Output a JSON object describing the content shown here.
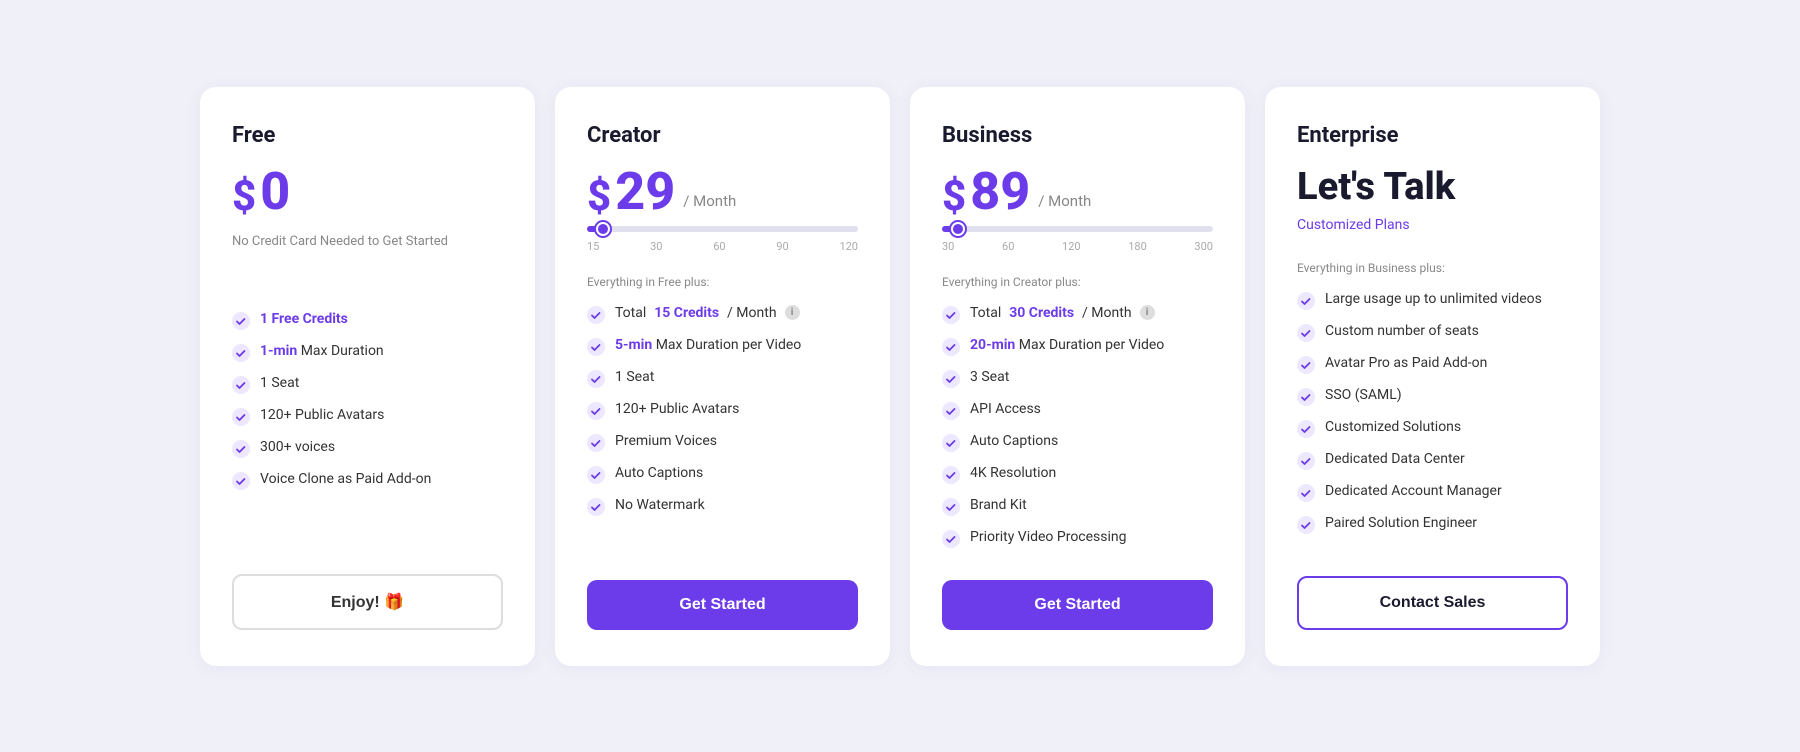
{
  "plans": [
    {
      "id": "free",
      "name": "Free",
      "price": "$0",
      "price_dollar": "$",
      "price_amount": "0",
      "price_period": null,
      "price_note": "No Credit Card Needed to Get Started",
      "has_slider": false,
      "section_header": null,
      "features": [
        {
          "text": "1 Free Credits",
          "highlight": "1 Free Credits"
        },
        {
          "text": "1-min Max Duration",
          "highlight": null
        },
        {
          "text": "1 Seat",
          "highlight": null
        },
        {
          "text": "120+ Public Avatars",
          "highlight": null
        },
        {
          "text": "300+ voices",
          "highlight": null
        },
        {
          "text": "Voice Clone as Paid Add-on",
          "highlight": null
        }
      ],
      "button_label": "Enjoy! 🎁",
      "button_type": "outline-gray"
    },
    {
      "id": "creator",
      "name": "Creator",
      "price_dollar": "$",
      "price_amount": "29",
      "price_period": "/ Month",
      "price_note": null,
      "has_slider": true,
      "slider_fill_pct": 6,
      "slider_thumb_pct": 6,
      "slider_labels": [
        "15",
        "30",
        "60",
        "90",
        "120"
      ],
      "section_header": "Everything in Free plus:",
      "features": [
        {
          "text": "Total 15 Credits / Month",
          "highlight": "15 Credits",
          "has_info": true
        },
        {
          "text": "5-min Max Duration per Video",
          "highlight": "5-min"
        },
        {
          "text": "1 Seat",
          "highlight": null
        },
        {
          "text": "120+ Public Avatars",
          "highlight": null
        },
        {
          "text": "Premium Voices",
          "highlight": null
        },
        {
          "text": "Auto Captions",
          "highlight": null
        },
        {
          "text": "No Watermark",
          "highlight": null
        }
      ],
      "button_label": "Get Started",
      "button_type": "primary"
    },
    {
      "id": "business",
      "name": "Business",
      "price_dollar": "$",
      "price_amount": "89",
      "price_period": "/ Month",
      "price_note": null,
      "has_slider": true,
      "slider_fill_pct": 6,
      "slider_thumb_pct": 6,
      "slider_labels": [
        "30",
        "60",
        "120",
        "180",
        "300"
      ],
      "section_header": "Everything in Creator plus:",
      "features": [
        {
          "text": "Total 30 Credits / Month",
          "highlight": "30 Credits",
          "has_info": true
        },
        {
          "text": "20-min Max Duration per Video",
          "highlight": "20-min"
        },
        {
          "text": "3 Seat",
          "highlight": null
        },
        {
          "text": "API Access",
          "highlight": null
        },
        {
          "text": "Auto Captions",
          "highlight": null
        },
        {
          "text": "4K Resolution",
          "highlight": null
        },
        {
          "text": "Brand Kit",
          "highlight": null
        },
        {
          "text": "Priority Video Processing",
          "highlight": null
        }
      ],
      "button_label": "Get Started",
      "button_type": "primary"
    },
    {
      "id": "enterprise",
      "name": "Enterprise",
      "price_text": "Let's Talk",
      "customized_plans": "Customized Plans",
      "has_slider": false,
      "section_header": "Everything in Business plus:",
      "features": [
        {
          "text": "Large usage up to unlimited videos",
          "highlight": null
        },
        {
          "text": "Custom number of seats",
          "highlight": null
        },
        {
          "text": "Avatar Pro as Paid Add-on",
          "highlight": null
        },
        {
          "text": "SSO (SAML)",
          "highlight": null
        },
        {
          "text": "Customized Solutions",
          "highlight": null
        },
        {
          "text": "Dedicated Data Center",
          "highlight": null
        },
        {
          "text": "Dedicated Account Manager",
          "highlight": null
        },
        {
          "text": "Paired Solution Engineer",
          "highlight": null
        }
      ],
      "button_label": "Contact Sales",
      "button_type": "outline"
    }
  ],
  "check_color": "#6c3bea",
  "accent_color": "#6c3bea"
}
